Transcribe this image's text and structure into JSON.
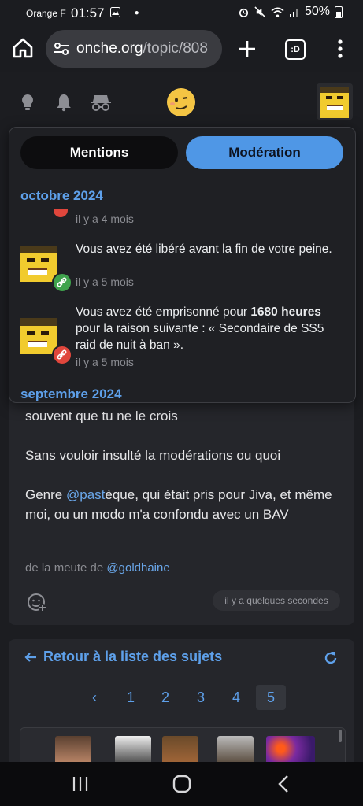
{
  "status_bar": {
    "carrier": "Orange F",
    "time": "01:57",
    "battery": "50%"
  },
  "browser": {
    "url_domain": "onche.org",
    "url_path": "/topic/808",
    "tabs_label": ":D"
  },
  "panel": {
    "tabs": [
      {
        "label": "Mentions",
        "active": false
      },
      {
        "label": "Modération",
        "active": true
      }
    ],
    "sections": [
      {
        "month": "octobre 2024"
      },
      {
        "month": "septembre 2024"
      }
    ],
    "partial_time": "il y a 4 mois",
    "notifications": [
      {
        "text": "Vous avez été libéré avant la fin de votre peine.",
        "time": "il y a 5 mois",
        "badge_color": "#3fa34d"
      },
      {
        "text_before": "Vous avez été emprisonné pour ",
        "text_bold": "1680 heures",
        "text_after": " pour la raison suivante : « Secondaire de SS5 raid de nuit à ban ».",
        "time": "il y a 5 mois",
        "badge_color": "#e0463c"
      }
    ]
  },
  "post": {
    "line1": "souvent que tu ne le crois",
    "line2": "Sans vouloir insulté la modérations ou quoi",
    "line3_pre": "Genre ",
    "line3_mention": "@past",
    "line3_post": "èque, qui était pris pour Jiva, et même moi, ou un modo m'a confondu avec un BAV",
    "meta_prefix": "de la meute de ",
    "meta_user": "@goldhaine",
    "timestamp": "il y a quelques secondes"
  },
  "topic_list": {
    "back_label": "Retour à la liste des sujets",
    "pages": [
      "1",
      "2",
      "3",
      "4",
      "5"
    ],
    "current_page": "5",
    "prev_symbol": "‹"
  },
  "colors": {
    "accent": "#5ea0ea",
    "background": "#1c1d21",
    "card": "#25262b"
  }
}
